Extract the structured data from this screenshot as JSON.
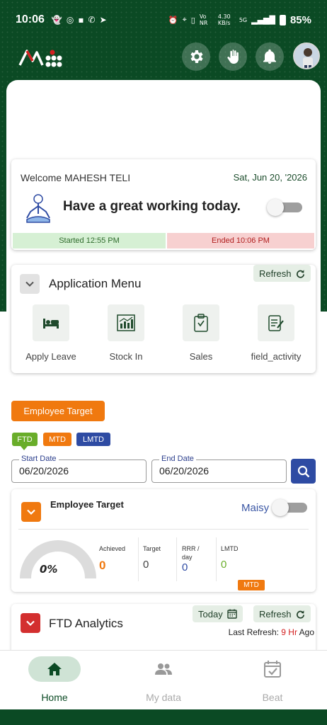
{
  "status_bar": {
    "time": "10:06",
    "network": "Vo NR",
    "speed": "4.30 KB/s",
    "signal": "5G",
    "battery": "85%"
  },
  "header": {
    "settings_icon": "gear-icon",
    "hand_icon": "hand-icon",
    "bell_icon": "bell-icon"
  },
  "welcome": {
    "greeting_name": "Welcome MAHESH TELI",
    "date": "Sat, Jun 20, '2026",
    "message": "Have a great working today.",
    "started": "Started 12:55 PM",
    "ended": "Ended 10:06 PM"
  },
  "app_menu": {
    "title": "Application Menu",
    "refresh_label": "Refresh",
    "items": [
      {
        "label": "Apply Leave",
        "icon": "bed-icon"
      },
      {
        "label": "Stock In",
        "icon": "chart-icon"
      },
      {
        "label": "Sales",
        "icon": "clipboard-icon"
      },
      {
        "label": "field_activity",
        "icon": "checklist-icon"
      }
    ]
  },
  "employee_target": {
    "button_label": "Employee Target",
    "chips": [
      "FTD",
      "MTD",
      "LMTD"
    ],
    "start_date_label": "Start Date",
    "start_date": "06/20/2026",
    "end_date_label": "End Date",
    "end_date": "06/20/2026",
    "card_title": "Employee Target",
    "maisy_label": "Maisy",
    "gauge_pct": "0%",
    "gauge_value": 0,
    "metrics": [
      {
        "label": "Achieved",
        "value": "0",
        "color": "#f0790f"
      },
      {
        "label": "Target",
        "value": "0",
        "color": "#444444"
      },
      {
        "label": "RRR / day",
        "value": "0",
        "color": "#2e4ba3"
      },
      {
        "label": "LMTD",
        "value": "0",
        "color": "#6aae2a"
      }
    ],
    "mtd_tag": "MTD"
  },
  "ftd_analytics": {
    "title": "FTD Analytics",
    "today_label": "Today",
    "refresh_label": "Refresh",
    "last_refresh_prefix": "Last Refresh:",
    "last_refresh_hours": "9 Hr",
    "last_refresh_suffix": "Ago"
  },
  "bottom_nav": {
    "items": [
      {
        "label": "Home",
        "active": true
      },
      {
        "label": "My data",
        "active": false
      },
      {
        "label": "Beat",
        "active": false
      }
    ]
  },
  "colors": {
    "brand_green": "#0b4a24",
    "accent_orange": "#f0790f",
    "accent_blue": "#2e4ba3",
    "red": "#d32f2f"
  }
}
